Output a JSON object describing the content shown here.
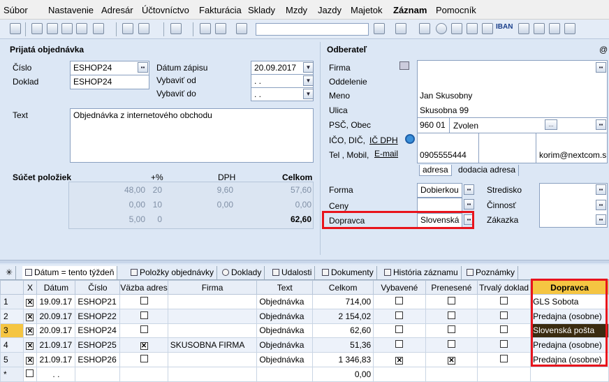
{
  "menu": [
    "Súbor",
    "Nastavenie",
    "Adresár",
    "Účtovníctvo",
    "Fakturácia",
    "Sklady",
    "Mzdy",
    "Jazdy",
    "Majetok",
    "Záznam",
    "Pomocník"
  ],
  "toolbar": {
    "iban": "IBAN",
    "search_value": ""
  },
  "order": {
    "section_title": "Prijatá objednávka",
    "cislo_label": "Číslo",
    "cislo_value": "ESHOP24",
    "doklad_label": "Doklad",
    "doklad_value": "ESHOP24",
    "datum_zapisu_label": "Dátum zápisu",
    "datum_zapisu_value": "20.09.2017",
    "vybavit_od_label": "Vybaviť od",
    "vybavit_od_value": ". .",
    "vybavit_do_label": "Vybaviť do",
    "vybavit_do_value": ". .",
    "text_label": "Text",
    "text_value": "Objednávka z internetového obchodu"
  },
  "summary": {
    "title": "Súčet položiek",
    "headers": [
      "+%",
      "DPH",
      "Celkom"
    ],
    "rows": [
      [
        "48,00",
        "20",
        "9,60",
        "57,60"
      ],
      [
        "0,00",
        "10",
        "0,00",
        "0,00"
      ],
      [
        "5,00",
        "0",
        "",
        "62,60"
      ]
    ]
  },
  "partner": {
    "section_title": "Odberateľ",
    "at": "@",
    "firma_label": "Firma",
    "firma_value": "",
    "oddelenie_label": "Oddelenie",
    "oddelenie_value": "",
    "meno_label": "Meno",
    "meno_value": "Jan Skusobny",
    "ulica_label": "Ulica",
    "ulica_value": "Skusobna 99",
    "psc_label": "PSČ, Obec",
    "psc_value": "960 01",
    "obec_value": "Zvolen",
    "ico_label": "IČO, DIČ,",
    "icdph_label": "IČ DPH",
    "tel_label": "Tel , Mobil,",
    "email_label": "E-mail",
    "tel_value": "0905555444",
    "email_value": "korim@nextcom.s",
    "tab_adresa": "adresa",
    "tab_dodacia": "dodacia adresa"
  },
  "details": {
    "forma_label": "Forma",
    "forma_value": "Dobierkou",
    "ceny_label": "Ceny",
    "dopravca_label": "Dopravca",
    "dopravca_value": "Slovenská p",
    "stredisko_label": "Stredisko",
    "cinnost_label": "Činnosť",
    "zakazka_label": "Zákazka"
  },
  "tabs": [
    "Dátum = tento týždeň",
    "Položky objednávky",
    "Doklady",
    "Udalosti",
    "Dokumenty",
    "História záznamu",
    "Poznámky"
  ],
  "grid": {
    "headers": [
      "",
      "X",
      "Dátum",
      "Číslo",
      "Väzba adres",
      "Firma",
      "Text",
      "Celkom",
      "Vybavené",
      "Prenesené",
      "Trvalý doklad",
      "Dopravca"
    ],
    "rows": [
      {
        "n": "1",
        "x": true,
        "datum": "19.09.17",
        "cislo": "ESHOP21",
        "vazba": false,
        "firma": "",
        "text": "Objednávka",
        "celkom": "714,00",
        "vybavene": false,
        "prenesene": false,
        "trvaly": false,
        "dopravca": "GLS Sobota"
      },
      {
        "n": "2",
        "x": true,
        "datum": "20.09.17",
        "cislo": "ESHOP22",
        "vazba": false,
        "firma": "",
        "text": "Objednávka",
        "celkom": "2 154,02",
        "vybavene": false,
        "prenesene": false,
        "trvaly": false,
        "dopravca": "Predajna (osobne)"
      },
      {
        "n": "3",
        "x": true,
        "datum": "20.09.17",
        "cislo": "ESHOP24",
        "vazba": false,
        "firma": "",
        "text": "Objednávka",
        "celkom": "62,60",
        "vybavene": false,
        "prenesene": false,
        "trvaly": false,
        "dopravca": "Slovenská pošta"
      },
      {
        "n": "4",
        "x": true,
        "datum": "21.09.17",
        "cislo": "ESHOP25",
        "vazba": true,
        "firma": "SKUSOBNA FIRMA",
        "text": "Objednávka",
        "celkom": "51,36",
        "vybavene": false,
        "prenesene": false,
        "trvaly": false,
        "dopravca": "Predajna (osobne)"
      },
      {
        "n": "5",
        "x": true,
        "datum": "21.09.17",
        "cislo": "ESHOP26",
        "vazba": false,
        "firma": "",
        "text": "Objednávka",
        "celkom": "1 346,83",
        "vybavene": true,
        "prenesene": true,
        "trvaly": false,
        "dopravca": "Predajna (osobne)"
      }
    ],
    "new_row": {
      "n": "*",
      "datum": ". .",
      "celkom": "0,00"
    }
  }
}
